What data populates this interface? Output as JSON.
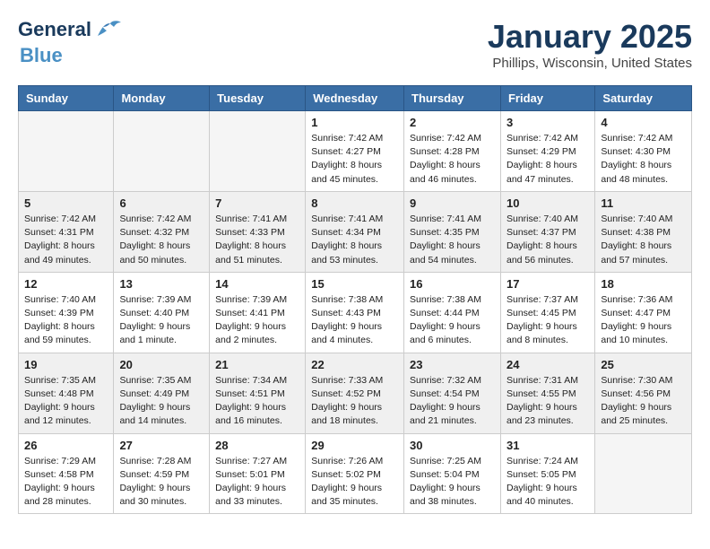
{
  "header": {
    "logo_line1": "General",
    "logo_line2": "Blue",
    "month": "January 2025",
    "location": "Phillips, Wisconsin, United States"
  },
  "weekdays": [
    "Sunday",
    "Monday",
    "Tuesday",
    "Wednesday",
    "Thursday",
    "Friday",
    "Saturday"
  ],
  "weeks": [
    [
      {
        "day": "",
        "info": ""
      },
      {
        "day": "",
        "info": ""
      },
      {
        "day": "",
        "info": ""
      },
      {
        "day": "1",
        "info": "Sunrise: 7:42 AM\nSunset: 4:27 PM\nDaylight: 8 hours\nand 45 minutes."
      },
      {
        "day": "2",
        "info": "Sunrise: 7:42 AM\nSunset: 4:28 PM\nDaylight: 8 hours\nand 46 minutes."
      },
      {
        "day": "3",
        "info": "Sunrise: 7:42 AM\nSunset: 4:29 PM\nDaylight: 8 hours\nand 47 minutes."
      },
      {
        "day": "4",
        "info": "Sunrise: 7:42 AM\nSunset: 4:30 PM\nDaylight: 8 hours\nand 48 minutes."
      }
    ],
    [
      {
        "day": "5",
        "info": "Sunrise: 7:42 AM\nSunset: 4:31 PM\nDaylight: 8 hours\nand 49 minutes."
      },
      {
        "day": "6",
        "info": "Sunrise: 7:42 AM\nSunset: 4:32 PM\nDaylight: 8 hours\nand 50 minutes."
      },
      {
        "day": "7",
        "info": "Sunrise: 7:41 AM\nSunset: 4:33 PM\nDaylight: 8 hours\nand 51 minutes."
      },
      {
        "day": "8",
        "info": "Sunrise: 7:41 AM\nSunset: 4:34 PM\nDaylight: 8 hours\nand 53 minutes."
      },
      {
        "day": "9",
        "info": "Sunrise: 7:41 AM\nSunset: 4:35 PM\nDaylight: 8 hours\nand 54 minutes."
      },
      {
        "day": "10",
        "info": "Sunrise: 7:40 AM\nSunset: 4:37 PM\nDaylight: 8 hours\nand 56 minutes."
      },
      {
        "day": "11",
        "info": "Sunrise: 7:40 AM\nSunset: 4:38 PM\nDaylight: 8 hours\nand 57 minutes."
      }
    ],
    [
      {
        "day": "12",
        "info": "Sunrise: 7:40 AM\nSunset: 4:39 PM\nDaylight: 8 hours\nand 59 minutes."
      },
      {
        "day": "13",
        "info": "Sunrise: 7:39 AM\nSunset: 4:40 PM\nDaylight: 9 hours\nand 1 minute."
      },
      {
        "day": "14",
        "info": "Sunrise: 7:39 AM\nSunset: 4:41 PM\nDaylight: 9 hours\nand 2 minutes."
      },
      {
        "day": "15",
        "info": "Sunrise: 7:38 AM\nSunset: 4:43 PM\nDaylight: 9 hours\nand 4 minutes."
      },
      {
        "day": "16",
        "info": "Sunrise: 7:38 AM\nSunset: 4:44 PM\nDaylight: 9 hours\nand 6 minutes."
      },
      {
        "day": "17",
        "info": "Sunrise: 7:37 AM\nSunset: 4:45 PM\nDaylight: 9 hours\nand 8 minutes."
      },
      {
        "day": "18",
        "info": "Sunrise: 7:36 AM\nSunset: 4:47 PM\nDaylight: 9 hours\nand 10 minutes."
      }
    ],
    [
      {
        "day": "19",
        "info": "Sunrise: 7:35 AM\nSunset: 4:48 PM\nDaylight: 9 hours\nand 12 minutes."
      },
      {
        "day": "20",
        "info": "Sunrise: 7:35 AM\nSunset: 4:49 PM\nDaylight: 9 hours\nand 14 minutes."
      },
      {
        "day": "21",
        "info": "Sunrise: 7:34 AM\nSunset: 4:51 PM\nDaylight: 9 hours\nand 16 minutes."
      },
      {
        "day": "22",
        "info": "Sunrise: 7:33 AM\nSunset: 4:52 PM\nDaylight: 9 hours\nand 18 minutes."
      },
      {
        "day": "23",
        "info": "Sunrise: 7:32 AM\nSunset: 4:54 PM\nDaylight: 9 hours\nand 21 minutes."
      },
      {
        "day": "24",
        "info": "Sunrise: 7:31 AM\nSunset: 4:55 PM\nDaylight: 9 hours\nand 23 minutes."
      },
      {
        "day": "25",
        "info": "Sunrise: 7:30 AM\nSunset: 4:56 PM\nDaylight: 9 hours\nand 25 minutes."
      }
    ],
    [
      {
        "day": "26",
        "info": "Sunrise: 7:29 AM\nSunset: 4:58 PM\nDaylight: 9 hours\nand 28 minutes."
      },
      {
        "day": "27",
        "info": "Sunrise: 7:28 AM\nSunset: 4:59 PM\nDaylight: 9 hours\nand 30 minutes."
      },
      {
        "day": "28",
        "info": "Sunrise: 7:27 AM\nSunset: 5:01 PM\nDaylight: 9 hours\nand 33 minutes."
      },
      {
        "day": "29",
        "info": "Sunrise: 7:26 AM\nSunset: 5:02 PM\nDaylight: 9 hours\nand 35 minutes."
      },
      {
        "day": "30",
        "info": "Sunrise: 7:25 AM\nSunset: 5:04 PM\nDaylight: 9 hours\nand 38 minutes."
      },
      {
        "day": "31",
        "info": "Sunrise: 7:24 AM\nSunset: 5:05 PM\nDaylight: 9 hours\nand 40 minutes."
      },
      {
        "day": "",
        "info": ""
      }
    ]
  ]
}
